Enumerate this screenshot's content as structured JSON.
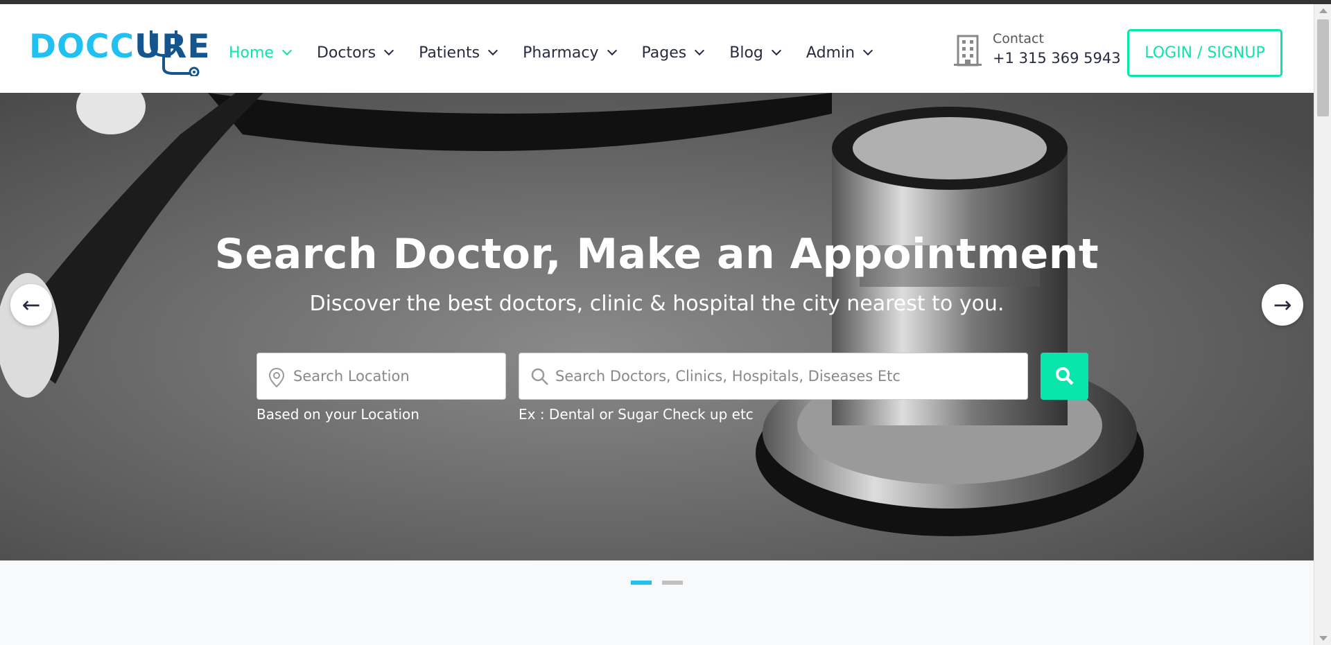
{
  "brand": {
    "logo_part1": "DOCC",
    "logo_part2": "U",
    "logo_part3": "RE"
  },
  "nav": [
    {
      "label": "Home",
      "active": true
    },
    {
      "label": "Doctors"
    },
    {
      "label": "Patients"
    },
    {
      "label": "Pharmacy"
    },
    {
      "label": "Pages"
    },
    {
      "label": "Blog"
    },
    {
      "label": "Admin"
    }
  ],
  "contact": {
    "label": "Contact",
    "phone": "+1 315 369 5943"
  },
  "login_label": "LOGIN / SIGNUP",
  "hero": {
    "title": "Search Doctor, Make an Appointment",
    "subtitle": "Discover the best doctors, clinic & hospital the city nearest to you.",
    "location_placeholder": "Search Location",
    "location_hint": "Based on your Location",
    "search_placeholder": "Search Doctors, Clinics, Hospitals, Diseases Etc",
    "search_hint": "Ex : Dental or Sugar Check up etc",
    "prev_arrow": "←",
    "next_arrow": "→"
  },
  "colors": {
    "accent": "#09e5ab",
    "brand_blue": "#20c0f3",
    "brand_dark": "#15558d"
  },
  "carousel": {
    "slide_count": 2,
    "active_index": 0
  }
}
